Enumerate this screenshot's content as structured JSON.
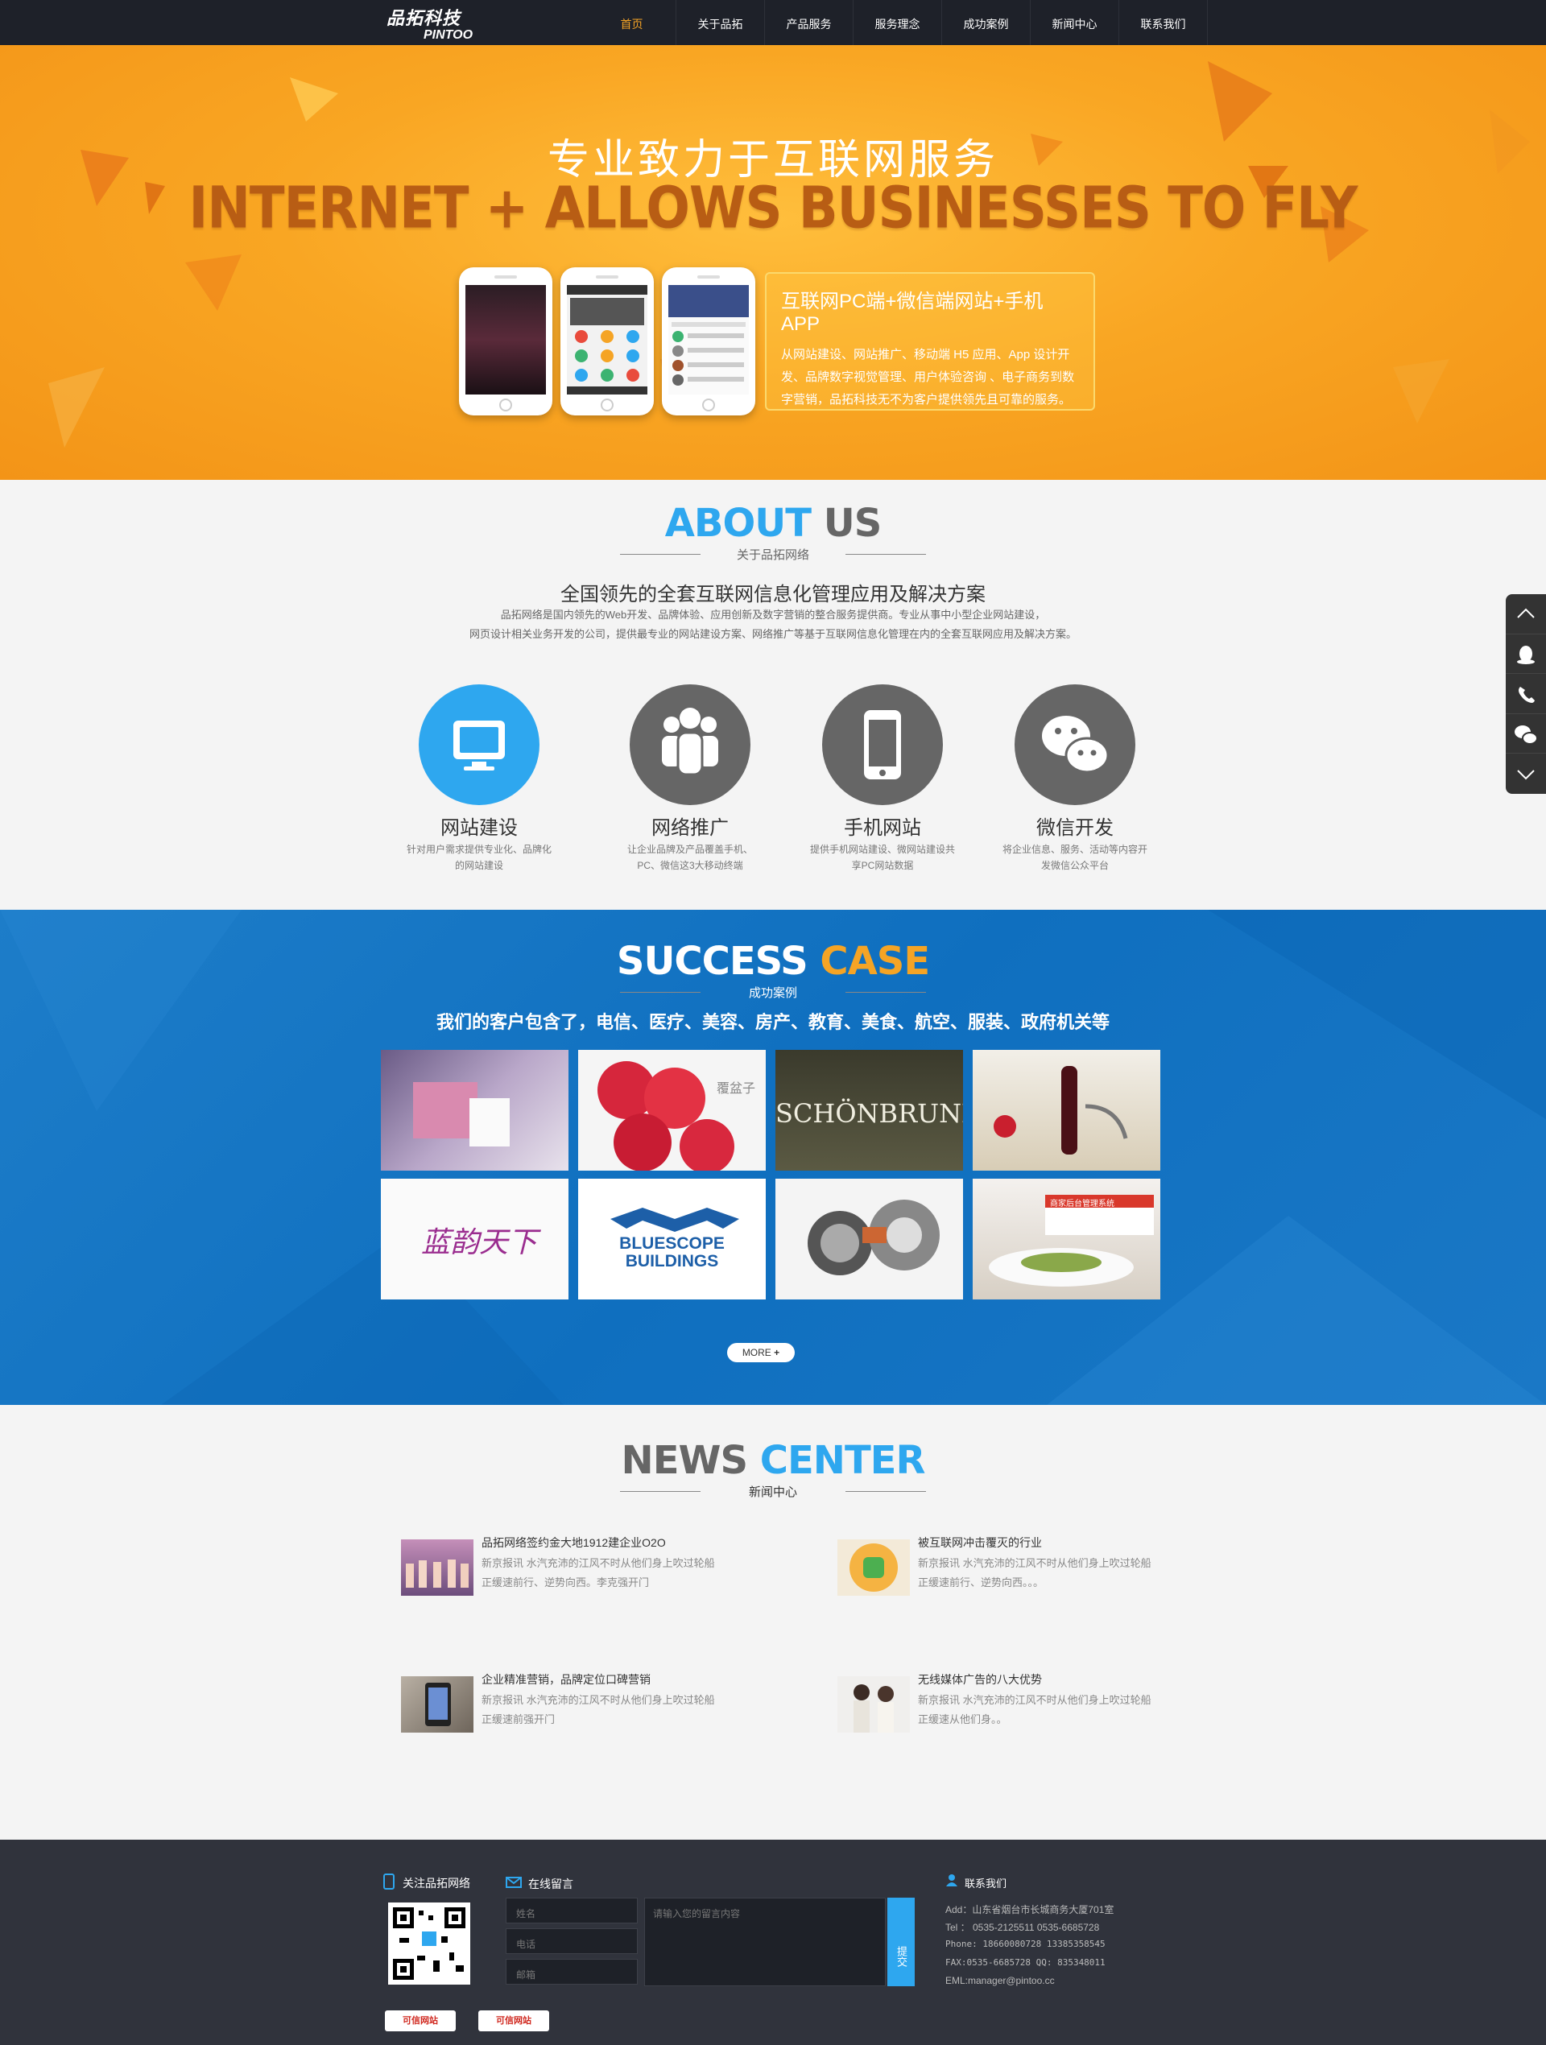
{
  "nav": {
    "logo_cn": "品拓科技",
    "logo_en": "PINTOO",
    "items": [
      {
        "label": "首页"
      },
      {
        "label": "关于品拓"
      },
      {
        "label": "产品服务"
      },
      {
        "label": "服务理念"
      },
      {
        "label": "成功案例"
      },
      {
        "label": "新闻中心"
      },
      {
        "label": "联系我们"
      }
    ]
  },
  "banner": {
    "headline": "专业致力于互联网服务",
    "tagline": "INTERNET +  ALLOWS BUSINESSES TO FLY",
    "box_title": "互联网PC端+微信端网站+手机APP",
    "box_desc": "从网站建设、网站推广、移动端 H5 应用、App 设计开发、品牌数字视觉管理、用户体验咨询 、电子商务到数字营销，品拓科技无不为客户提供领先且可靠的服务。"
  },
  "about": {
    "title_a": "ABOUT",
    "title_b": "US",
    "subtitle": "关于品拓网络",
    "heading": "全国领先的全套互联网信息化管理应用及解决方案",
    "desc_1": "品拓网络是国内领先的Web开发、品牌体验、应用创新及数字营销的整合服务提供商。专业从事中小型企业网站建设，",
    "desc_2": "网页设计相关业务开发的公司，提供最专业的网站建设方案、网络推广等基于互联网信息化管理在内的全套互联网应用及解决方案。",
    "services": [
      {
        "name": "网站建设",
        "desc": "针对用户需求提供专业化、品牌化的网站建设",
        "icon": "monitor-icon"
      },
      {
        "name": "网络推广",
        "desc": "让企业品牌及产品覆盖手机、PC、微信这3大移动终端",
        "icon": "people-icon"
      },
      {
        "name": "手机网站",
        "desc": "提供手机网站建设、微网站建设共享PC网站数据",
        "icon": "phone-icon"
      },
      {
        "name": "微信开发",
        "desc": "将企业信息、服务、活动等内容开发微信公众平台",
        "icon": "wechat-icon"
      }
    ]
  },
  "cases": {
    "title_a": "SUCCESS",
    "title_b": "CASE",
    "subtitle": "成功案例",
    "slogan": "我们的客户包含了，电信、医疗、美容、房产、教育、美食、航空、服装、政府机关等",
    "thumbs": [
      {
        "caption": ""
      },
      {
        "caption": "覆盆子"
      },
      {
        "caption": "SCHÖNBRUNN"
      },
      {
        "caption": ""
      },
      {
        "caption": "蓝韵天下"
      },
      {
        "caption_1": "BLUESCOPE",
        "caption_2": "BUILDINGS"
      },
      {
        "caption": ""
      },
      {
        "caption": "商家后台管理系统"
      }
    ],
    "more": "MORE"
  },
  "news": {
    "title_a": "NEWS",
    "title_b": "CENTER",
    "subtitle": "新闻中心",
    "items": [
      {
        "title": "品拓网络签约金大地1912建企业O2O",
        "desc": "新京报讯 水汽充沛的江风不时从他们身上吹过轮船正缓速前行、逆势向西。李克强开门"
      },
      {
        "title": "被互联网冲击覆灭的行业",
        "desc": "新京报讯 水汽充沛的江风不时从他们身上吹过轮船正缓速前行、逆势向西。。。"
      },
      {
        "title": "企业精准营销，品牌定位口碑营销",
        "desc": "新京报讯 水汽充沛的江风不时从他们身上吹过轮船正缓速前强开门"
      },
      {
        "title": "无线媒体广告的八大优势",
        "desc": "新京报讯 水汽充沛的江风不时从他们身上吹过轮船正缓速从他们身。。"
      }
    ]
  },
  "footer": {
    "follow": "关注品拓网络",
    "message": "在线留言",
    "contact": "联系我们",
    "name_ph": "姓名",
    "phone_ph": "电话",
    "email_ph": "邮箱",
    "msg_ph": "请输入您的留言内容",
    "submit": "提交",
    "add": "Add：山东省烟台市长城商务大厦701室",
    "tel": "Tel ： 0535-2125511  0535-6685728",
    "mobile": "Phone: 18660080728 13385358545",
    "fax": "FAX:0535-6685728   QQ: 835348011",
    "eml": "EML:manager@pintoo.cc",
    "badge_1": "可信网站",
    "badge_2": "可信网站"
  },
  "colors": {
    "nav_bg": "#1e2129",
    "accent_orange": "#f5a425",
    "accent_blue": "#2ea7ef",
    "case_bg": "#1576c4",
    "footer_bg": "#30333c"
  }
}
